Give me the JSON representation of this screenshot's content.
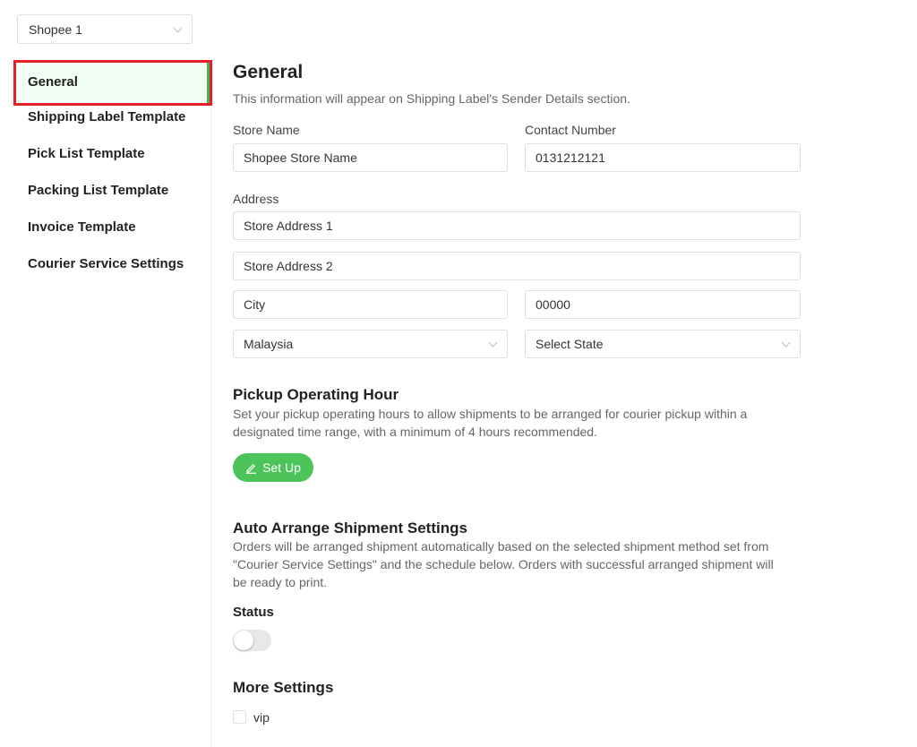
{
  "store_select": {
    "value": "Shopee 1"
  },
  "sidebar": {
    "items": [
      {
        "label": "General"
      },
      {
        "label": "Shipping Label Template"
      },
      {
        "label": "Pick List Template"
      },
      {
        "label": "Packing List Template"
      },
      {
        "label": "Invoice Template"
      },
      {
        "label": "Courier Service Settings"
      }
    ]
  },
  "general": {
    "title": "General",
    "subtitle": "This information will appear on Shipping Label's Sender Details section.",
    "store_name_label": "Store Name",
    "store_name_value": "Shopee Store Name",
    "contact_label": "Contact Number",
    "contact_value": "0131212121",
    "address_label": "Address",
    "address1": "Store Address 1",
    "address2": "Store Address 2",
    "city": "City",
    "postcode": "00000",
    "country": "Malaysia",
    "state": "Select State"
  },
  "pickup": {
    "title": "Pickup Operating Hour",
    "description": "Set your pickup operating hours to allow shipments to be arranged for courier pickup within a designated time range, with a minimum of 4 hours recommended.",
    "button_label": "Set Up",
    "button_icon": "edit-icon"
  },
  "auto_arrange": {
    "title": "Auto Arrange Shipment Settings",
    "description": "Orders will be arranged shipment automatically based on the selected shipment method set from \"Courier Service Settings\" and the schedule below. Orders with successful arranged shipment will be ready to print.",
    "status_label": "Status",
    "status_on": false
  },
  "more_settings": {
    "title": "More Settings",
    "checkbox_label": "vip",
    "checked": false
  },
  "colors": {
    "accent": "#4cc45a",
    "highlight_border": "#e51f2a"
  }
}
